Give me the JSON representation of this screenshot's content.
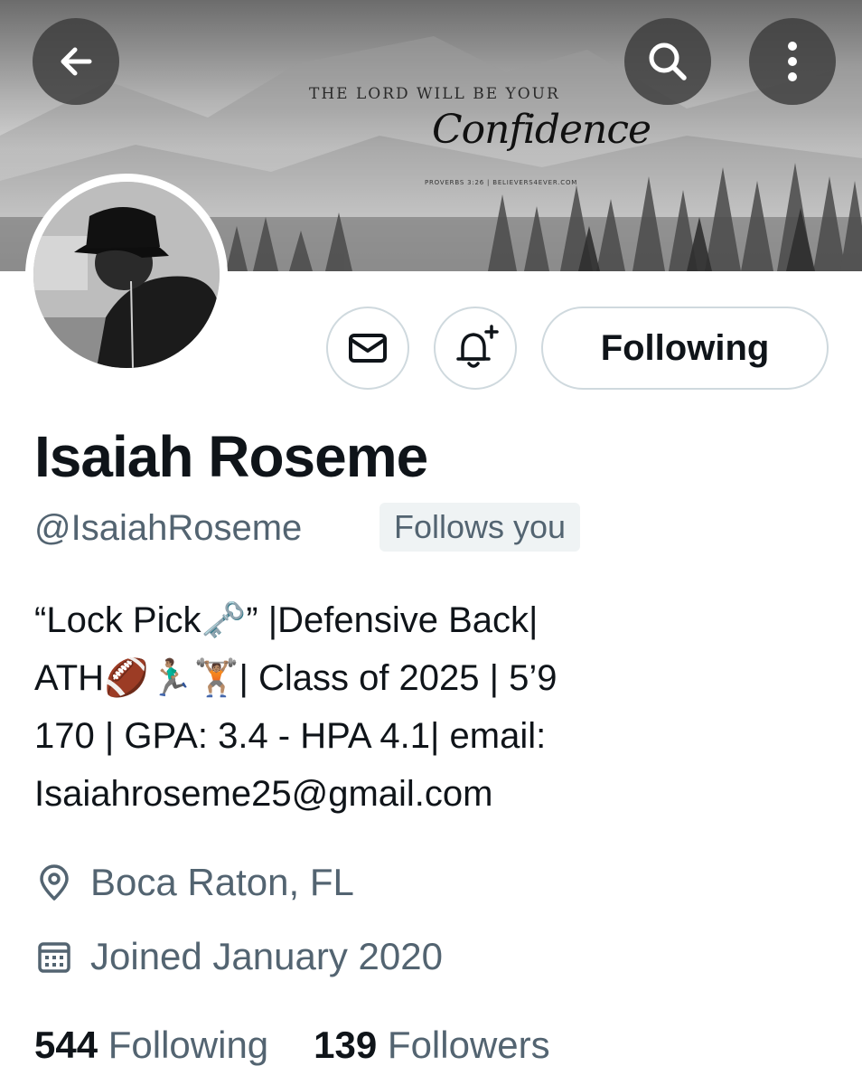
{
  "header": {
    "back_icon": "arrow-left-icon",
    "search_icon": "search-icon",
    "more_icon": "more-vertical-icon",
    "banner_text": {
      "line1": "THE LORD WILL BE YOUR",
      "script": "Confidence",
      "reference": "PROVERBS 3:26 | BELIEVERS4EVER.COM"
    }
  },
  "actions": {
    "message_icon": "envelope-icon",
    "notify_icon": "bell-plus-icon",
    "following_label": "Following"
  },
  "profile": {
    "display_name": "Isaiah Roseme",
    "handle": "@IsaiahRoseme",
    "follows_you": "Follows you",
    "bio_line1": "“Lock Pick🗝️” |Defensive Back|",
    "bio_line2": "ATH🏈🏃🏽‍♂️🏋🏽| Class of 2025 | 5’9",
    "bio_line3": "170 | GPA: 3.4 - HPA 4.1| email:",
    "bio_line4": "Isaiahroseme25@gmail.com",
    "location": "Boca Raton, FL",
    "joined": "Joined January 2020"
  },
  "stats": {
    "following_count": "544",
    "following_label": "Following",
    "followers_count": "139",
    "followers_label": "Followers"
  },
  "colors": {
    "text_primary": "#0f1419",
    "text_secondary": "#536471",
    "border": "#cfd9de",
    "badge_bg": "#eff3f4"
  }
}
